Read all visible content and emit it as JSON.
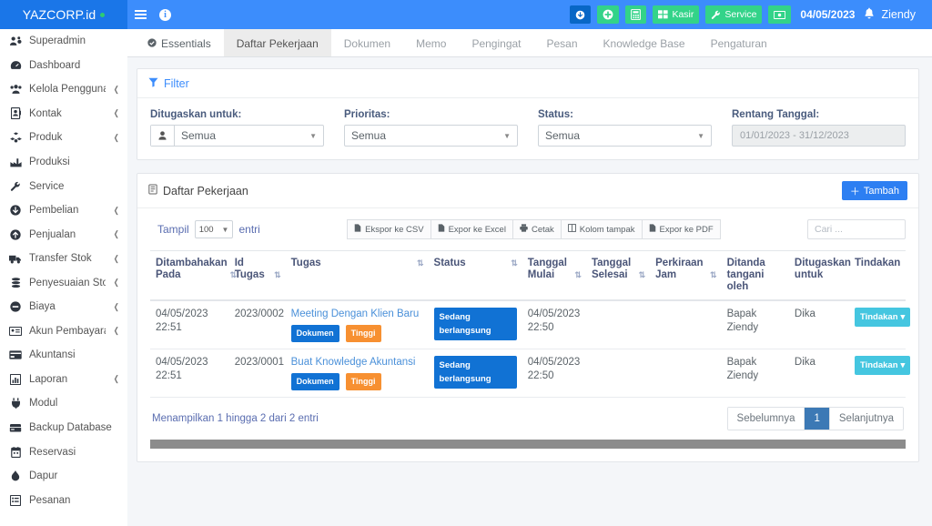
{
  "brand": {
    "name": "YAZCORP.id",
    "status_dot_color": "#2ecc71"
  },
  "navbar": {
    "menu_icon": "hamburger-icon",
    "info_icon": "info-icon",
    "buttons": [
      {
        "label": "",
        "icon": "download-circle-icon",
        "color": "#0867c6"
      },
      {
        "label": "",
        "icon": "plus-circle-icon",
        "color": "#33d389"
      },
      {
        "label": "",
        "icon": "calculator-icon",
        "color": "#33d389"
      },
      {
        "label": "Kasir",
        "icon": "cash-register-icon",
        "color": "#33d389"
      },
      {
        "label": "Service",
        "icon": "wrench-icon",
        "color": "#33d389"
      },
      {
        "label": "",
        "icon": "money-bill-icon",
        "color": "#33d389"
      }
    ],
    "date": "04/05/2023",
    "bell_icon": "bell-icon",
    "user": "Ziendy"
  },
  "sidebar": {
    "items": [
      {
        "label": "Superadmin",
        "icon": "users-cog-icon",
        "caret": false
      },
      {
        "label": "Dashboard",
        "icon": "tachometer-icon",
        "caret": false
      },
      {
        "label": "Kelola Pengguna",
        "icon": "users-icon",
        "caret": true
      },
      {
        "label": "Kontak",
        "icon": "address-book-icon",
        "caret": true
      },
      {
        "label": "Produk",
        "icon": "cubes-icon",
        "caret": true
      },
      {
        "label": "Produksi",
        "icon": "industry-icon",
        "caret": false
      },
      {
        "label": "Service",
        "icon": "wrench-icon",
        "caret": false
      },
      {
        "label": "Pembelian",
        "icon": "arrow-down-circle-icon",
        "caret": true
      },
      {
        "label": "Penjualan",
        "icon": "arrow-up-circle-icon",
        "caret": true
      },
      {
        "label": "Transfer Stok",
        "icon": "truck-icon",
        "caret": true
      },
      {
        "label": "Penyesuaian Stok",
        "icon": "layers-icon",
        "caret": true
      },
      {
        "label": "Biaya",
        "icon": "minus-circle-icon",
        "caret": true
      },
      {
        "label": "Akun Pembayaran",
        "icon": "id-card-icon",
        "caret": true
      },
      {
        "label": "Akuntansi",
        "icon": "credit-card-icon",
        "caret": false
      },
      {
        "label": "Laporan",
        "icon": "chart-bar-icon",
        "caret": true
      },
      {
        "label": "Modul",
        "icon": "plug-icon",
        "caret": false
      },
      {
        "label": "Backup Database",
        "icon": "database-icon",
        "caret": false
      },
      {
        "label": "Reservasi",
        "icon": "calendar-icon",
        "caret": false
      },
      {
        "label": "Dapur",
        "icon": "fire-icon",
        "caret": false
      },
      {
        "label": "Pesanan",
        "icon": "list-alt-icon",
        "caret": false
      }
    ]
  },
  "tabs": [
    {
      "label": "Essentials",
      "active": false,
      "icon": "check-circle-icon"
    },
    {
      "label": "Daftar Pekerjaan",
      "active": true,
      "icon": ""
    },
    {
      "label": "Dokumen",
      "active": false,
      "icon": ""
    },
    {
      "label": "Memo",
      "active": false,
      "icon": ""
    },
    {
      "label": "Pengingat",
      "active": false,
      "icon": ""
    },
    {
      "label": "Pesan",
      "active": false,
      "icon": ""
    },
    {
      "label": "Knowledge Base",
      "active": false,
      "icon": ""
    },
    {
      "label": "Pengaturan",
      "active": false,
      "icon": ""
    }
  ],
  "filter_card": {
    "title": "Filter",
    "icon": "filter-icon",
    "fields": [
      {
        "label": "Ditugaskan untuk:",
        "value": "Semua",
        "addon_icon": "user-icon"
      },
      {
        "label": "Prioritas:",
        "value": "Semua",
        "addon_icon": ""
      },
      {
        "label": "Status:",
        "value": "Semua",
        "addon_icon": ""
      }
    ],
    "date_range": {
      "label": "Rentang Tanggal:",
      "value": "01/01/2023 - 31/12/2023"
    }
  },
  "list_card": {
    "title": "Daftar Pekerjaan",
    "icon": "clipboard-icon",
    "add_button": "Tambah",
    "show_prefix": "Tampil",
    "show_value": "100",
    "show_suffix": "entri",
    "export_buttons": [
      {
        "label": "Ekspor ke CSV",
        "icon": "file-csv-icon"
      },
      {
        "label": "Expor ke Excel",
        "icon": "file-excel-icon"
      },
      {
        "label": "Cetak",
        "icon": "print-icon"
      },
      {
        "label": "Kolom tampak",
        "icon": "columns-icon"
      },
      {
        "label": "Expor ke PDF",
        "icon": "file-pdf-icon"
      }
    ],
    "search_placeholder": "Cari ...",
    "columns": [
      {
        "label": "Ditambahakan Pada",
        "sortable": true,
        "sorted": "desc"
      },
      {
        "label": "Id Tugas",
        "sortable": true,
        "sorted": "none"
      },
      {
        "label": "Tugas",
        "sortable": true,
        "sorted": "none"
      },
      {
        "label": "Status",
        "sortable": true,
        "sorted": "none"
      },
      {
        "label": "Tanggal Mulai",
        "sortable": true,
        "sorted": "none"
      },
      {
        "label": "Tanggal Selesai",
        "sortable": true,
        "sorted": "none"
      },
      {
        "label": "Perkiraan Jam",
        "sortable": true,
        "sorted": "none"
      },
      {
        "label": "Ditanda tangani oleh",
        "sortable": false,
        "sorted": "none"
      },
      {
        "label": "Ditugaskan untuk",
        "sortable": false,
        "sorted": "none"
      },
      {
        "label": "Tindakan",
        "sortable": false,
        "sorted": "none"
      }
    ],
    "rows": [
      {
        "added_at": "04/05/2023 22:51",
        "task_id": "2023/0002",
        "task": "Meeting Dengan Klien Baru",
        "tags": [
          {
            "label": "Dokumen",
            "color": "#1172d4"
          },
          {
            "label": "Tinggi",
            "color": "#f79031"
          }
        ],
        "status": "Sedang berlangsung",
        "start_date": "04/05/2023 22:50",
        "end_date": "",
        "est_hours": "",
        "signed_by": "Bapak Ziendy",
        "assigned_to": "Dika",
        "action": "Tindakan"
      },
      {
        "added_at": "04/05/2023 22:51",
        "task_id": "2023/0001",
        "task": "Buat Knowledge Akuntansi",
        "tags": [
          {
            "label": "Dokumen",
            "color": "#1172d4"
          },
          {
            "label": "Tinggi",
            "color": "#f79031"
          }
        ],
        "status": "Sedang berlangsung",
        "start_date": "04/05/2023 22:50",
        "end_date": "",
        "est_hours": "",
        "signed_by": "Bapak Ziendy",
        "assigned_to": "Dika",
        "action": "Tindakan"
      }
    ],
    "footer_info": "Menampilkan 1 hingga 2 dari 2 entri",
    "pagination": {
      "prev": "Sebelumnya",
      "pages": [
        "1"
      ],
      "next": "Selanjutnya",
      "current": "1"
    }
  }
}
